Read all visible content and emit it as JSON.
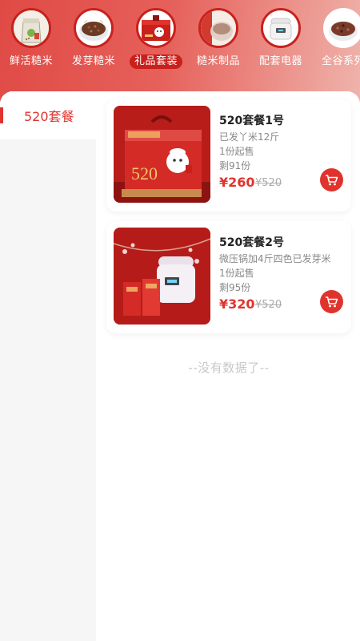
{
  "categories": [
    {
      "label": "鲜活糙米",
      "icon": "rice-bag-icon",
      "active": false
    },
    {
      "label": "发芽糙米",
      "icon": "germinated-rice-icon",
      "active": false
    },
    {
      "label": "礼品套装",
      "icon": "gift-box-icon",
      "active": true
    },
    {
      "label": "糙米制品",
      "icon": "rice-drink-icon",
      "active": false
    },
    {
      "label": "配套电器",
      "icon": "rice-cooker-icon",
      "active": false
    },
    {
      "label": "全谷系列",
      "icon": "whole-grain-icon",
      "active": false
    }
  ],
  "sidebar": {
    "items": [
      {
        "label": "520套餐",
        "active": true
      }
    ]
  },
  "products": [
    {
      "name": "520套餐1号",
      "desc": "已发丫米12斤",
      "min_order": "1份起售",
      "stock": "剩91份",
      "price": "¥260",
      "old_price": "¥520",
      "image": "gift-box-520-image"
    },
    {
      "name": "520套餐2号",
      "desc": "微压锅加4斤四色已发芽米",
      "min_order": "1份起售",
      "stock": "剩95份",
      "price": "¥320",
      "old_price": "¥520",
      "image": "rice-cooker-gift-image"
    }
  ],
  "footer": {
    "no_more": "--没有数据了--"
  },
  "colors": {
    "accent": "#e0332d",
    "header_start": "#e04a45",
    "header_end": "#efb5ad",
    "muted_text": "#888888"
  }
}
